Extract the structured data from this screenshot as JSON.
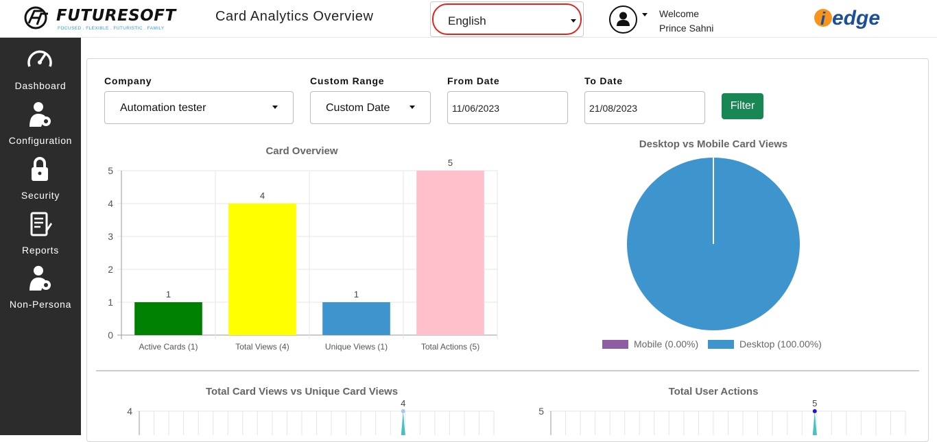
{
  "header": {
    "logo_text": "FUTURESOFT",
    "logo_tagline": "FOCUSED . FLEXIBLE . FUTURISTIC . FAMILY",
    "title": "Card Analytics Overview",
    "language": "English",
    "welcome_label": "Welcome",
    "user_name": "Prince Sahni",
    "brand_right": "edge",
    "brand_right_prefix": "i"
  },
  "sidebar": {
    "items": [
      {
        "label": "Dashboard",
        "icon": "dashboard-gauge-icon"
      },
      {
        "label": "Configuration",
        "icon": "user-gear-icon"
      },
      {
        "label": "Security",
        "icon": "lock-icon"
      },
      {
        "label": "Reports",
        "icon": "report-icon"
      },
      {
        "label": "Non-Persona",
        "icon": "user-gear-icon"
      }
    ]
  },
  "filters": {
    "company_label": "Company",
    "company_value": "Automation tester",
    "range_label": "Custom Range",
    "range_value": "Custom Date",
    "from_label": "From Date",
    "from_value": "11/06/2023",
    "to_label": "To Date",
    "to_value": "21/08/2023",
    "filter_button": "Filter"
  },
  "colors": {
    "sidebar_bg": "#2c2c2c",
    "filter_btn": "#198754",
    "lang_border": "#e2231a",
    "desktop": "#3e95cd",
    "mobile": "#8e5ea2",
    "line_series": "#4bc0c0"
  },
  "chart_data": [
    {
      "type": "bar",
      "title": "Card Overview",
      "categories": [
        "Active Cards (1)",
        "Total Views (4)",
        "Unique Views (1)",
        "Total Actions (5)"
      ],
      "values": [
        1,
        4,
        1,
        5
      ],
      "data_labels": [
        "1",
        "4",
        "1",
        "5"
      ],
      "colors": [
        "#008000",
        "#ffff00",
        "#3e95cd",
        "#ffc0cb"
      ],
      "yticks": [
        "0",
        "1",
        "2",
        "3",
        "4",
        "5"
      ],
      "ylim": [
        0,
        5
      ],
      "grid": true
    },
    {
      "type": "pie",
      "title": "Desktop vs Mobile Card Views",
      "legend": [
        {
          "name": "Mobile (0.00%)",
          "color": "#8e5ea2"
        },
        {
          "name": "Desktop (100.00%)",
          "color": "#3e95cd"
        }
      ],
      "values": [
        0,
        100
      ],
      "legend_position": "bottom"
    },
    {
      "type": "line",
      "title": "Total Card Views vs Unique Card Views",
      "ytick_visible": "4",
      "peak_label": "4",
      "peak_value": 4,
      "grid": true
    },
    {
      "type": "line",
      "title": "Total User Actions",
      "ytick_visible": "5",
      "peak_label": "5",
      "peak_value": 5,
      "grid": true
    }
  ]
}
